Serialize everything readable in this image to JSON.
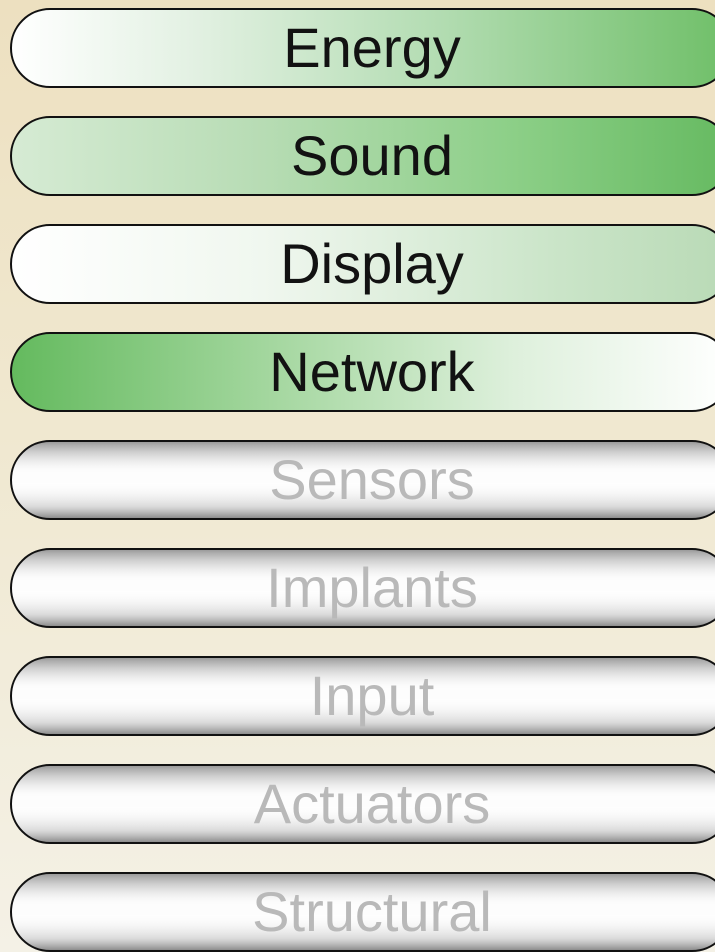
{
  "menu": {
    "items": [
      {
        "label": "Energy",
        "state": "active"
      },
      {
        "label": "Sound",
        "state": "active"
      },
      {
        "label": "Display",
        "state": "active"
      },
      {
        "label": "Network",
        "state": "active"
      },
      {
        "label": "Sensors",
        "state": "inactive"
      },
      {
        "label": "Implants",
        "state": "inactive"
      },
      {
        "label": "Input",
        "state": "inactive"
      },
      {
        "label": "Actuators",
        "state": "inactive"
      },
      {
        "label": "Structural",
        "state": "inactive"
      }
    ]
  },
  "colors": {
    "active_green": "#66ba61",
    "active_text": "#121212",
    "inactive_text": "#b9b9b9",
    "outline": "#111111",
    "background_top": "#ede0c0",
    "background_bottom": "#f4f1e6"
  }
}
